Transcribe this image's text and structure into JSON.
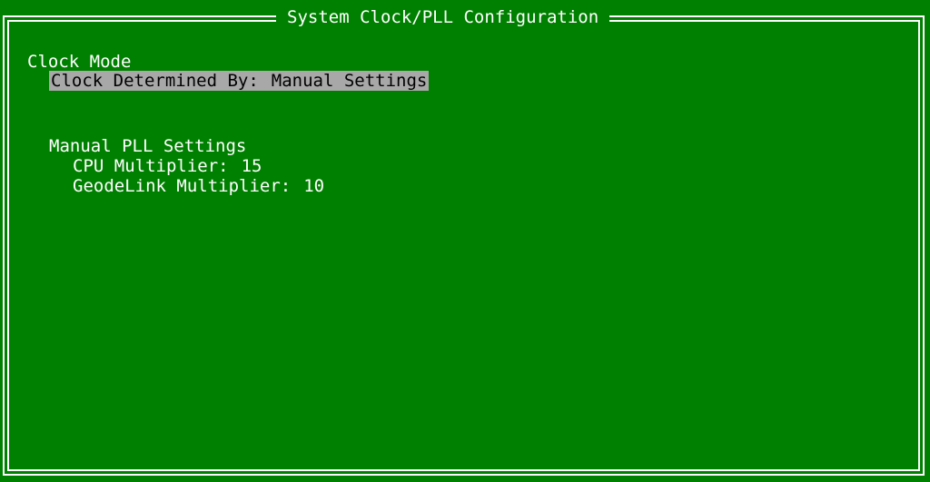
{
  "window": {
    "title": "System Clock/PLL Configuration"
  },
  "clock_mode": {
    "heading": "Clock Mode",
    "determined_by_label": "Clock Determined By:",
    "determined_by_value": "Manual Settings"
  },
  "manual_pll": {
    "heading": "Manual PLL Settings",
    "cpu_multiplier_label": "CPU Multiplier:",
    "cpu_multiplier_value": "15",
    "geodelink_multiplier_label": "GeodeLink Multiplier:",
    "geodelink_multiplier_value": "10"
  },
  "colors": {
    "background": "#008000",
    "foreground": "#ffffff",
    "selection_background": "#a8a8a8",
    "selection_foreground": "#000000"
  }
}
